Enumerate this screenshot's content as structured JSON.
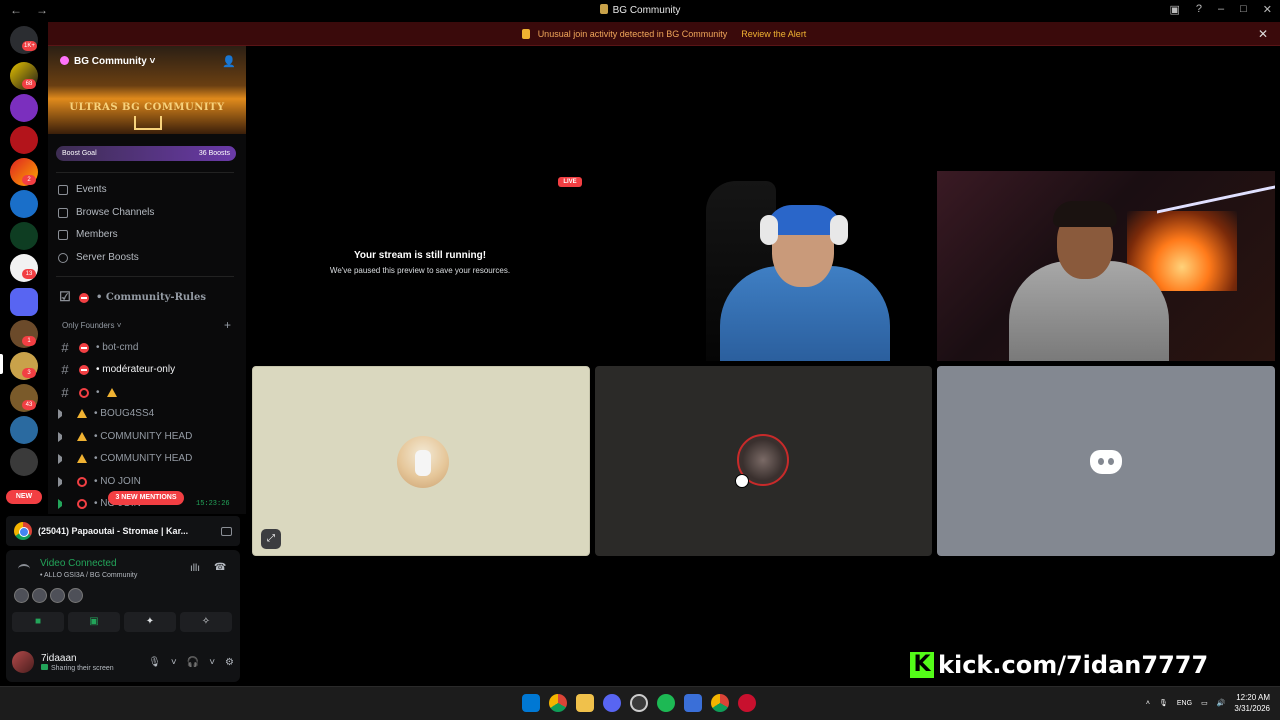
{
  "window": {
    "title": "BG Community"
  },
  "alert": {
    "text": "Unusual join activity detected in BG Community",
    "link": "Review the Alert"
  },
  "rail": {
    "badges": [
      "1K+",
      "68",
      "2",
      "13",
      "1",
      "3",
      "43"
    ],
    "new_label": "NEW"
  },
  "server": {
    "name": "BG Community",
    "banner_text": "ULTRAS BG COMMUNITY",
    "boost_goal": "Boost Goal",
    "boost_count": "36 Boosts"
  },
  "nav": {
    "events": "Events",
    "browse": "Browse Channels",
    "members": "Members",
    "server_boosts": "Server Boosts"
  },
  "channels": {
    "rules": "• Community-Rules",
    "category": "Only Founders",
    "bot_cmd": "• bot-cmd",
    "moderateur": "• modérateur-only",
    "warn_channel": "•",
    "boug": "• BOUG4SS4",
    "head1": "• COMMUNITY HEAD",
    "head2": "• COMMUNITY HEAD",
    "nojoin": "• NO JOIN",
    "nojoin2": "• NO JOIN"
  },
  "mentions": "3 NEW MENTIONS",
  "voice_timer": "15:23:26",
  "activity": {
    "title": "(25041) Papaoutai - Stromae | Kar..."
  },
  "voice": {
    "status": "Video Connected",
    "channel": "• ALLO GSI3A / BG Community"
  },
  "user": {
    "name": "7idaaan",
    "status": "Sharing their screen"
  },
  "stage": {
    "live": "LIVE",
    "paused_title": "Your stream is still running!",
    "paused_sub": "We've paused this preview to save your resources."
  },
  "overlay": {
    "kick": "kick.com/7idan7777",
    "kick_logo": "K"
  },
  "taskbar": {
    "lang": "ENG",
    "time": "12:20 AM",
    "date": "3/31/2026"
  },
  "colors": {
    "accent": "#5865f2",
    "danger": "#f23f43",
    "online": "#23a55a",
    "kick": "#53fc18",
    "warning": "#f0b232"
  }
}
